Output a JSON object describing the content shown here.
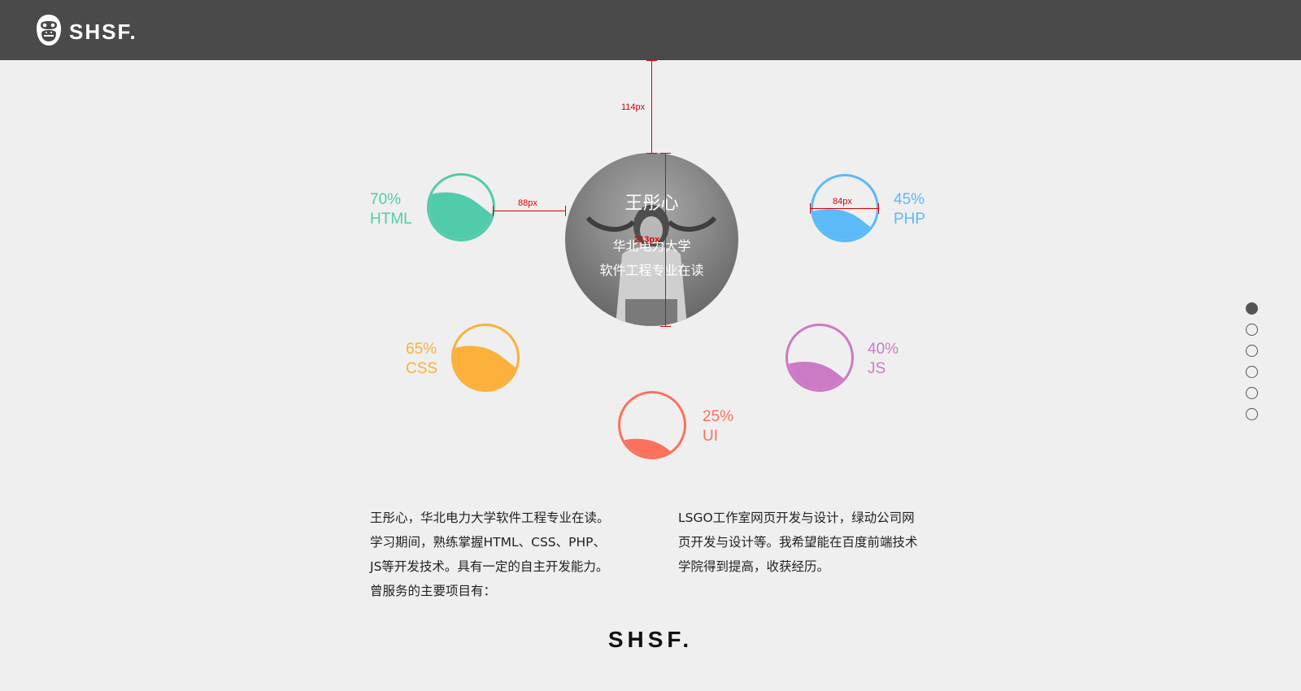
{
  "header": {
    "logo_text": "SHSF.",
    "logo_icon": "gorilla-icon",
    "background": "#4a4a4a"
  },
  "profile": {
    "name": "王彤心",
    "line1": "华北电力大学",
    "line2": "软件工程专业在读"
  },
  "skills": [
    {
      "percent": "70%",
      "name": "HTML",
      "level": 0.7,
      "color": "#52cbab"
    },
    {
      "percent": "45%",
      "name": "PHP",
      "level": 0.45,
      "color": "#5bbaf7"
    },
    {
      "percent": "65%",
      "name": "CSS",
      "level": 0.65,
      "color": "#fbb03b"
    },
    {
      "percent": "40%",
      "name": "JS",
      "level": 0.4,
      "color": "#cc7ac5"
    },
    {
      "percent": "25%",
      "name": "UI",
      "level": 0.25,
      "color": "#fb715e"
    }
  ],
  "measurements": {
    "top_gap": "114px",
    "html_gap": "88px",
    "profile_size": "213px",
    "skill_size": "84px"
  },
  "pagination": {
    "count": 6,
    "active": 1
  },
  "description": {
    "left": [
      "王彤心，华北电力大学软件工程专业在读。",
      "学习期间，熟练掌握HTML、CSS、PHP、",
      "JS等开发技术。具有一定的自主开发能力。",
      "曾服务的主要项目有："
    ],
    "right": [
      "LSGO工作室网页开发与设计，绿动公司网",
      "页开发与设计等。我希望能在百度前端技术",
      "学院得到提高，收获经历。"
    ]
  },
  "footer": {
    "logo_text": "SHSF."
  }
}
